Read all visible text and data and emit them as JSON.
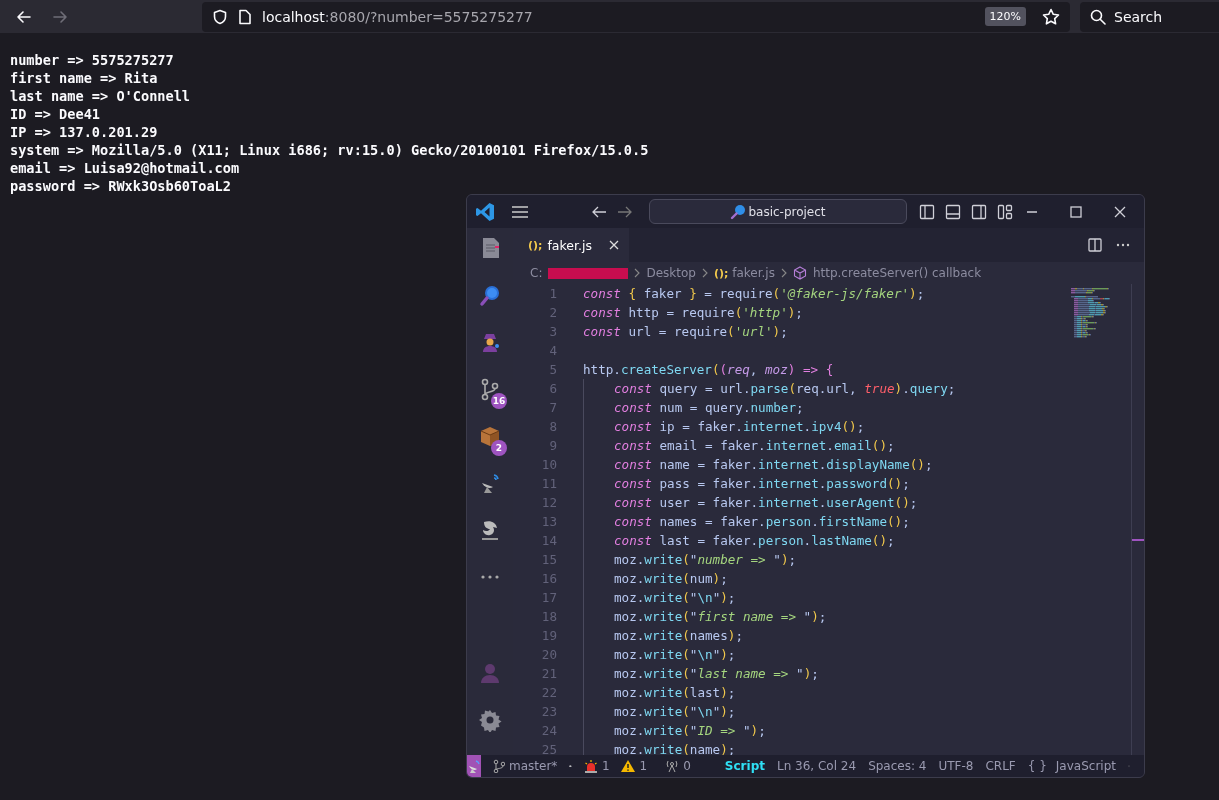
{
  "browser": {
    "url_host": "localhost",
    "url_rest": ":8080/?number=5575275277",
    "zoom": "120%",
    "search_placeholder": "Search",
    "forward_disabled": true
  },
  "page_lines": [
    "number => 5575275277",
    "first name => Rita",
    "last name => O'Connell",
    "ID => Dee41",
    "IP => 137.0.201.29",
    "system => Mozilla/5.0 (X11; Linux i686; rv:15.0) Gecko/20100101 Firefox/15.0.5",
    "email => Luisa92@hotmail.com",
    "password => RWxk3Osb60ToaL2"
  ],
  "editor": {
    "title": "basic-project",
    "activity_items": [
      {
        "kind": "files"
      },
      {
        "kind": "search"
      },
      {
        "kind": "agent"
      },
      {
        "kind": "source-control",
        "badge": "16"
      },
      {
        "kind": "extensions",
        "badge": "2"
      },
      {
        "kind": "remote"
      },
      {
        "kind": "scrypt"
      },
      {
        "kind": "more"
      },
      {
        "kind": "account"
      },
      {
        "kind": "settings"
      }
    ],
    "tabs": [
      {
        "glyph": "();",
        "label": "faker.js",
        "selected": true
      }
    ],
    "breadcrumb": {
      "drive": "C:",
      "folder": "Desktop",
      "file_glyph": "();",
      "file": "faker.js",
      "symbol": "http.createServer() callback"
    },
    "code_lines": [
      {
        "number": "1",
        "indented": false,
        "tokens": [
          {
            "kind": "kw",
            "text": "const"
          },
          {
            "kind": "br",
            "text": " {"
          },
          {
            "kind": "id",
            "text": " faker "
          },
          {
            "kind": "br",
            "text": "}"
          },
          {
            "kind": "id",
            "text": " = require"
          },
          {
            "kind": "br",
            "text": "("
          },
          {
            "kind": "st",
            "text": "'@faker-js/faker'"
          },
          {
            "kind": "br",
            "text": ")"
          },
          {
            "kind": "id",
            "text": ";"
          }
        ]
      },
      {
        "number": "2",
        "indented": false,
        "tokens": [
          {
            "kind": "kw",
            "text": "const"
          },
          {
            "kind": "id",
            "text": " http = require"
          },
          {
            "kind": "br",
            "text": "("
          },
          {
            "kind": "st",
            "text": "'http'"
          },
          {
            "kind": "br",
            "text": ")"
          },
          {
            "kind": "id",
            "text": ";"
          }
        ]
      },
      {
        "number": "3",
        "indented": false,
        "tokens": [
          {
            "kind": "kw",
            "text": "const"
          },
          {
            "kind": "id",
            "text": " url = require"
          },
          {
            "kind": "br",
            "text": "("
          },
          {
            "kind": "st",
            "text": "'url'"
          },
          {
            "kind": "br",
            "text": ")"
          },
          {
            "kind": "id",
            "text": ";"
          }
        ]
      },
      {
        "number": "4"
      },
      {
        "number": "5",
        "indented": false,
        "tokens": [
          {
            "kind": "id",
            "text": "http."
          },
          {
            "kind": "fn",
            "text": "createServer"
          },
          {
            "kind": "br",
            "text": "("
          },
          {
            "kind": "op",
            "text": "("
          },
          {
            "kind": "pa",
            "text": "req"
          },
          {
            "kind": "id",
            "text": ", "
          },
          {
            "kind": "pa",
            "text": "moz"
          },
          {
            "kind": "op",
            "text": ") => {"
          }
        ]
      },
      {
        "number": "6",
        "indented": true,
        "tokens": [
          {
            "kind": "kw",
            "text": "const"
          },
          {
            "kind": "id",
            "text": " query = url."
          },
          {
            "kind": "fn",
            "text": "parse"
          },
          {
            "kind": "br",
            "text": "("
          },
          {
            "kind": "id",
            "text": "req.url, "
          },
          {
            "kind": "bo",
            "text": "true"
          },
          {
            "kind": "br",
            "text": ")"
          },
          {
            "kind": "id",
            "text": "."
          },
          {
            "kind": "fn",
            "text": "query"
          },
          {
            "kind": "id",
            "text": ";"
          }
        ]
      },
      {
        "number": "7",
        "indented": true,
        "tokens": [
          {
            "kind": "kw",
            "text": "const"
          },
          {
            "kind": "id",
            "text": " num = query."
          },
          {
            "kind": "fn",
            "text": "number"
          },
          {
            "kind": "id",
            "text": ";"
          }
        ]
      },
      {
        "number": "8",
        "indented": true,
        "tokens": [
          {
            "kind": "kw",
            "text": "const"
          },
          {
            "kind": "id",
            "text": " ip = faker."
          },
          {
            "kind": "fn",
            "text": "internet"
          },
          {
            "kind": "id",
            "text": "."
          },
          {
            "kind": "fn",
            "text": "ipv4"
          },
          {
            "kind": "br",
            "text": "()"
          },
          {
            "kind": "id",
            "text": ";"
          }
        ]
      },
      {
        "number": "9",
        "indented": true,
        "tokens": [
          {
            "kind": "kw",
            "text": "const"
          },
          {
            "kind": "id",
            "text": " email = faker."
          },
          {
            "kind": "fn",
            "text": "internet"
          },
          {
            "kind": "id",
            "text": "."
          },
          {
            "kind": "fn",
            "text": "email"
          },
          {
            "kind": "br",
            "text": "()"
          },
          {
            "kind": "id",
            "text": ";"
          }
        ]
      },
      {
        "number": "10",
        "indented": true,
        "tokens": [
          {
            "kind": "kw",
            "text": "const"
          },
          {
            "kind": "id",
            "text": " name = faker."
          },
          {
            "kind": "fn",
            "text": "internet"
          },
          {
            "kind": "id",
            "text": "."
          },
          {
            "kind": "fn",
            "text": "displayName"
          },
          {
            "kind": "br",
            "text": "()"
          },
          {
            "kind": "id",
            "text": ";"
          }
        ]
      },
      {
        "number": "11",
        "indented": true,
        "tokens": [
          {
            "kind": "kw",
            "text": "const"
          },
          {
            "kind": "id",
            "text": " pass = faker."
          },
          {
            "kind": "fn",
            "text": "internet"
          },
          {
            "kind": "id",
            "text": "."
          },
          {
            "kind": "fn",
            "text": "password"
          },
          {
            "kind": "br",
            "text": "()"
          },
          {
            "kind": "id",
            "text": ";"
          }
        ]
      },
      {
        "number": "12",
        "indented": true,
        "tokens": [
          {
            "kind": "kw",
            "text": "const"
          },
          {
            "kind": "id",
            "text": " user = faker."
          },
          {
            "kind": "fn",
            "text": "internet"
          },
          {
            "kind": "id",
            "text": "."
          },
          {
            "kind": "fn",
            "text": "userAgent"
          },
          {
            "kind": "br",
            "text": "()"
          },
          {
            "kind": "id",
            "text": ";"
          }
        ]
      },
      {
        "number": "13",
        "indented": true,
        "tokens": [
          {
            "kind": "kw",
            "text": "const"
          },
          {
            "kind": "id",
            "text": " names = faker."
          },
          {
            "kind": "fn",
            "text": "person"
          },
          {
            "kind": "id",
            "text": "."
          },
          {
            "kind": "fn",
            "text": "firstName"
          },
          {
            "kind": "br",
            "text": "()"
          },
          {
            "kind": "id",
            "text": ";"
          }
        ]
      },
      {
        "number": "14",
        "indented": true,
        "tokens": [
          {
            "kind": "kw",
            "text": "const"
          },
          {
            "kind": "id",
            "text": " last = faker."
          },
          {
            "kind": "fn",
            "text": "person"
          },
          {
            "kind": "id",
            "text": "."
          },
          {
            "kind": "fn",
            "text": "lastName"
          },
          {
            "kind": "br",
            "text": "()"
          },
          {
            "kind": "id",
            "text": ";"
          }
        ]
      },
      {
        "number": "15",
        "indented": true,
        "tokens": [
          {
            "kind": "id",
            "text": "moz."
          },
          {
            "kind": "fn",
            "text": "write"
          },
          {
            "kind": "br",
            "text": "("
          },
          {
            "kind": "id",
            "text": "\""
          },
          {
            "kind": "st",
            "text": "number => "
          },
          {
            "kind": "id",
            "text": "\""
          },
          {
            "kind": "br",
            "text": ")"
          },
          {
            "kind": "id",
            "text": ";"
          }
        ]
      },
      {
        "number": "16",
        "indented": true,
        "tokens": [
          {
            "kind": "id",
            "text": "moz."
          },
          {
            "kind": "fn",
            "text": "write"
          },
          {
            "kind": "br",
            "text": "("
          },
          {
            "kind": "id",
            "text": "num"
          },
          {
            "kind": "br",
            "text": ")"
          },
          {
            "kind": "id",
            "text": ";"
          }
        ]
      },
      {
        "number": "17",
        "indented": true,
        "tokens": [
          {
            "kind": "id",
            "text": "moz."
          },
          {
            "kind": "fn",
            "text": "write"
          },
          {
            "kind": "br",
            "text": "("
          },
          {
            "kind": "id",
            "text": "\""
          },
          {
            "kind": "fn",
            "text": "\\n"
          },
          {
            "kind": "id",
            "text": "\""
          },
          {
            "kind": "br",
            "text": ")"
          },
          {
            "kind": "id",
            "text": ";"
          }
        ]
      },
      {
        "number": "18",
        "indented": true,
        "tokens": [
          {
            "kind": "id",
            "text": "moz."
          },
          {
            "kind": "fn",
            "text": "write"
          },
          {
            "kind": "br",
            "text": "("
          },
          {
            "kind": "id",
            "text": "\""
          },
          {
            "kind": "st",
            "text": "first name => "
          },
          {
            "kind": "id",
            "text": "\""
          },
          {
            "kind": "br",
            "text": ")"
          },
          {
            "kind": "id",
            "text": ";"
          }
        ]
      },
      {
        "number": "19",
        "indented": true,
        "tokens": [
          {
            "kind": "id",
            "text": "moz."
          },
          {
            "kind": "fn",
            "text": "write"
          },
          {
            "kind": "br",
            "text": "("
          },
          {
            "kind": "id",
            "text": "names"
          },
          {
            "kind": "br",
            "text": ")"
          },
          {
            "kind": "id",
            "text": ";"
          }
        ]
      },
      {
        "number": "20",
        "indented": true,
        "tokens": [
          {
            "kind": "id",
            "text": "moz."
          },
          {
            "kind": "fn",
            "text": "write"
          },
          {
            "kind": "br",
            "text": "("
          },
          {
            "kind": "id",
            "text": "\""
          },
          {
            "kind": "fn",
            "text": "\\n"
          },
          {
            "kind": "id",
            "text": "\""
          },
          {
            "kind": "br",
            "text": ")"
          },
          {
            "kind": "id",
            "text": ";"
          }
        ]
      },
      {
        "number": "21",
        "indented": true,
        "tokens": [
          {
            "kind": "id",
            "text": "moz."
          },
          {
            "kind": "fn",
            "text": "write"
          },
          {
            "kind": "br",
            "text": "("
          },
          {
            "kind": "id",
            "text": "\""
          },
          {
            "kind": "st",
            "text": "last name => "
          },
          {
            "kind": "id",
            "text": "\""
          },
          {
            "kind": "br",
            "text": ")"
          },
          {
            "kind": "id",
            "text": ";"
          }
        ]
      },
      {
        "number": "22",
        "indented": true,
        "tokens": [
          {
            "kind": "id",
            "text": "moz."
          },
          {
            "kind": "fn",
            "text": "write"
          },
          {
            "kind": "br",
            "text": "("
          },
          {
            "kind": "id",
            "text": "last"
          },
          {
            "kind": "br",
            "text": ")"
          },
          {
            "kind": "id",
            "text": ";"
          }
        ]
      },
      {
        "number": "23",
        "indented": true,
        "tokens": [
          {
            "kind": "id",
            "text": "moz."
          },
          {
            "kind": "fn",
            "text": "write"
          },
          {
            "kind": "br",
            "text": "("
          },
          {
            "kind": "id",
            "text": "\""
          },
          {
            "kind": "fn",
            "text": "\\n"
          },
          {
            "kind": "id",
            "text": "\""
          },
          {
            "kind": "br",
            "text": ")"
          },
          {
            "kind": "id",
            "text": ";"
          }
        ]
      },
      {
        "number": "24",
        "indented": true,
        "tokens": [
          {
            "kind": "id",
            "text": "moz."
          },
          {
            "kind": "fn",
            "text": "write"
          },
          {
            "kind": "br",
            "text": "("
          },
          {
            "kind": "id",
            "text": "\""
          },
          {
            "kind": "st",
            "text": "ID => "
          },
          {
            "kind": "id",
            "text": "\""
          },
          {
            "kind": "br",
            "text": ")"
          },
          {
            "kind": "id",
            "text": ";"
          }
        ]
      },
      {
        "number": "25",
        "indented": true,
        "tokens": [
          {
            "kind": "id",
            "text": "moz."
          },
          {
            "kind": "fn",
            "text": "write"
          },
          {
            "kind": "br",
            "text": "("
          },
          {
            "kind": "id",
            "text": "name"
          },
          {
            "kind": "br",
            "text": ")"
          },
          {
            "kind": "id",
            "text": ";"
          }
        ]
      }
    ],
    "status_bar": {
      "branch": "master*",
      "errors": "1",
      "warnings": "1",
      "ports": "0",
      "mode": "Script",
      "position": "Ln 36, Col 24",
      "indent": "Spaces: 4",
      "encoding": "UTF-8",
      "eol": "CRLF",
      "language_glyph": "{ }",
      "language": "JavaScript"
    }
  }
}
